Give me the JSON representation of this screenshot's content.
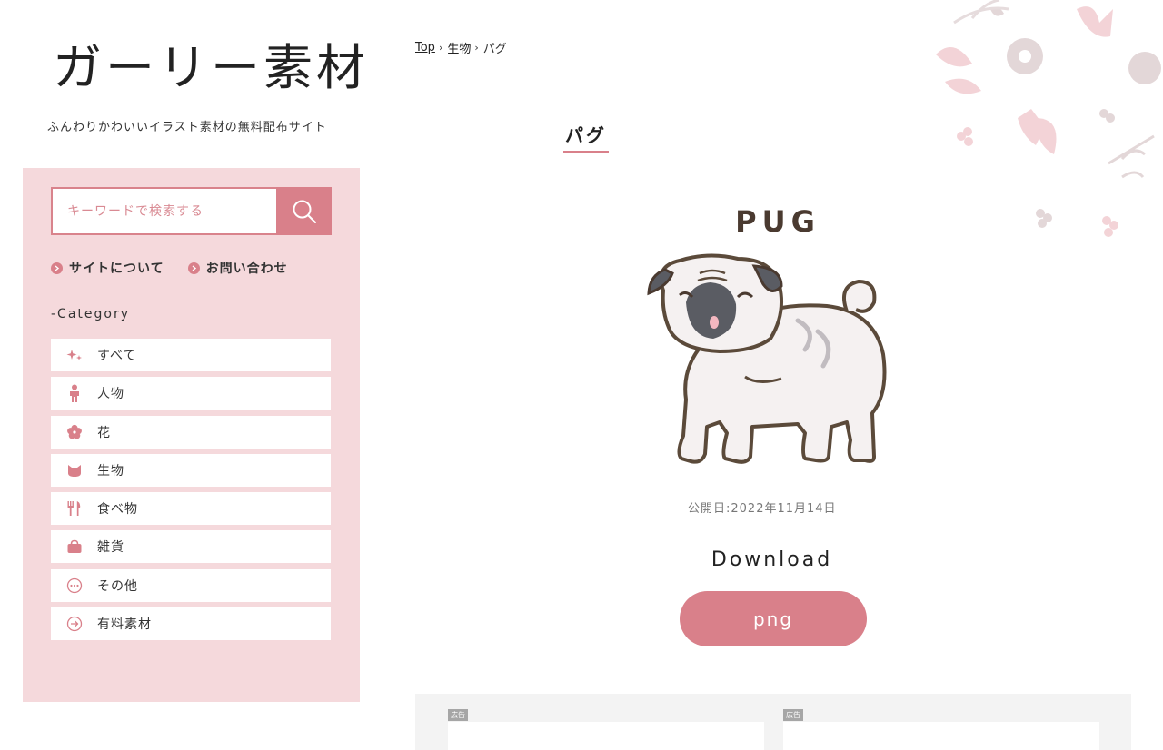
{
  "site": {
    "title": "ガーリー素材",
    "tagline": "ふんわりかわいいイラスト素材の無料配布サイト"
  },
  "search": {
    "placeholder": "キーワードで検索する",
    "button_icon": "search-icon"
  },
  "sub_links": [
    {
      "label": "サイトについて"
    },
    {
      "label": "お問い合わせ"
    }
  ],
  "category": {
    "heading": "-Category",
    "items": [
      {
        "label": "すべて",
        "icon": "sparkle-icon"
      },
      {
        "label": "人物",
        "icon": "person-icon"
      },
      {
        "label": "花",
        "icon": "flower-icon"
      },
      {
        "label": "生物",
        "icon": "cat-icon"
      },
      {
        "label": "食べ物",
        "icon": "fork-knife-icon"
      },
      {
        "label": "雑貨",
        "icon": "bag-icon"
      },
      {
        "label": "その他",
        "icon": "more-icon"
      },
      {
        "label": "有料素材",
        "icon": "arrow-circle-icon"
      }
    ]
  },
  "breadcrumb": {
    "items": [
      {
        "label": "Top",
        "link": true
      },
      {
        "label": "生物",
        "link": true
      },
      {
        "label": "パグ",
        "link": false
      }
    ]
  },
  "article": {
    "title": "パグ",
    "illustration_caption": "PUG",
    "published": "公開日:2022年11月14日",
    "download_heading": "Download",
    "download_button": "png"
  },
  "ads": [
    {
      "label": "広告"
    },
    {
      "label": "広告"
    }
  ],
  "colors": {
    "accent": "#d9808a",
    "sidebar_bg": "#f5d9dc"
  }
}
